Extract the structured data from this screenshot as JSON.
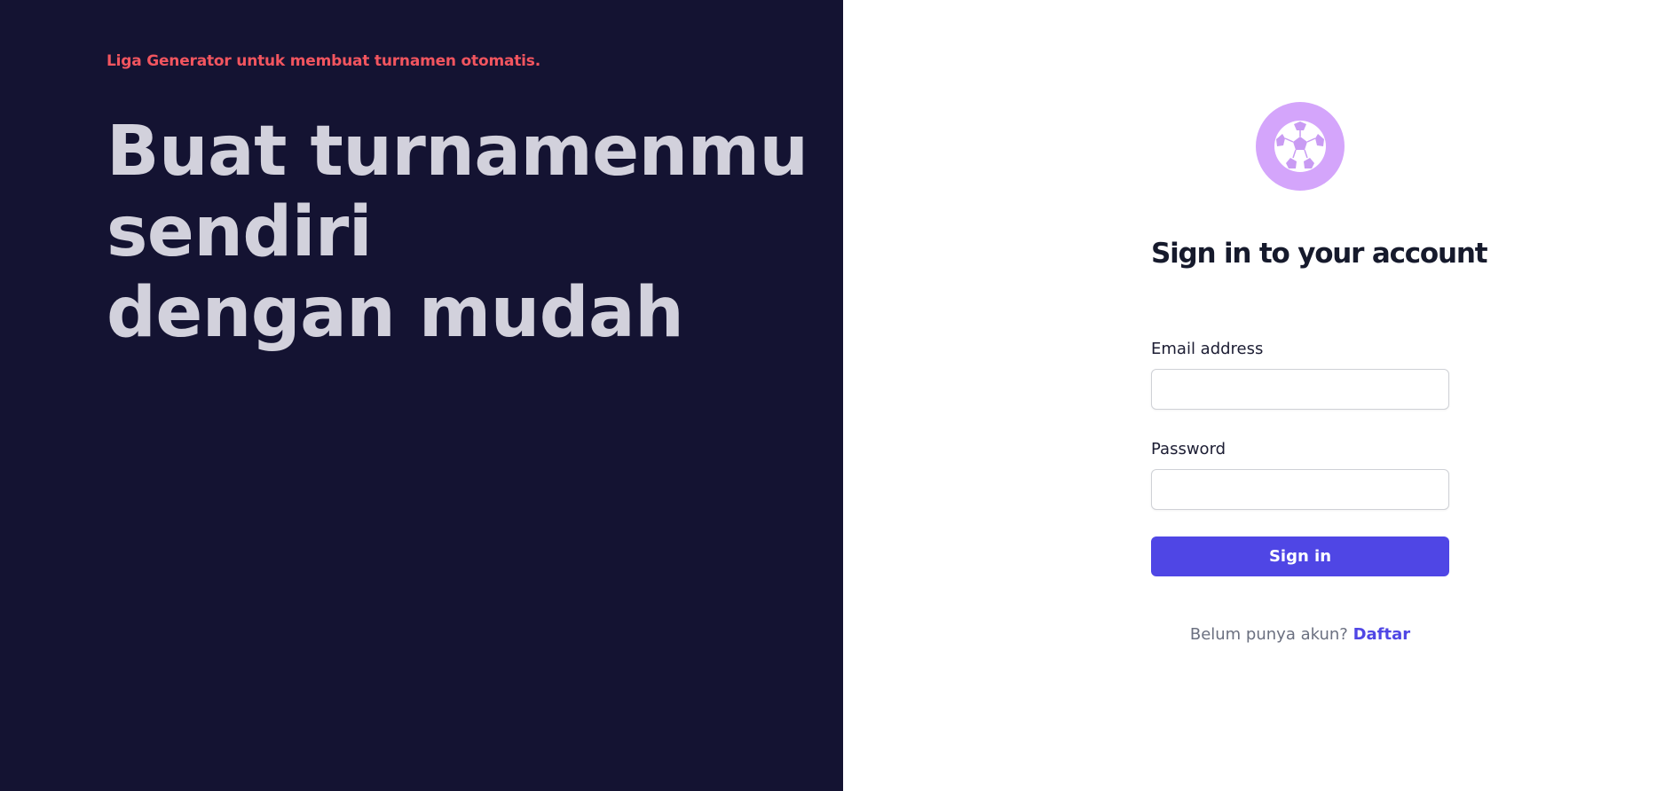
{
  "hero": {
    "tagline": "Liga Generator untuk membuat turnamen otomatis.",
    "lines": [
      "Buat turnamenmu",
      "sendiri",
      "dengan mudah"
    ]
  },
  "logo": {
    "icon": "soccer-ball-icon"
  },
  "form": {
    "title": "Sign in to your account",
    "email_label": "Email address",
    "email_value": "",
    "password_label": "Password",
    "password_value": "",
    "submit_label": "Sign in"
  },
  "signup": {
    "prompt": "Belum punya akun?",
    "link_label": "Daftar"
  },
  "colors": {
    "left_background": "#141332",
    "tagline": "#f2555f",
    "hero_text": "#d2d1dc",
    "accent": "#4f46e5",
    "logo_background": "#d4a5fb"
  }
}
